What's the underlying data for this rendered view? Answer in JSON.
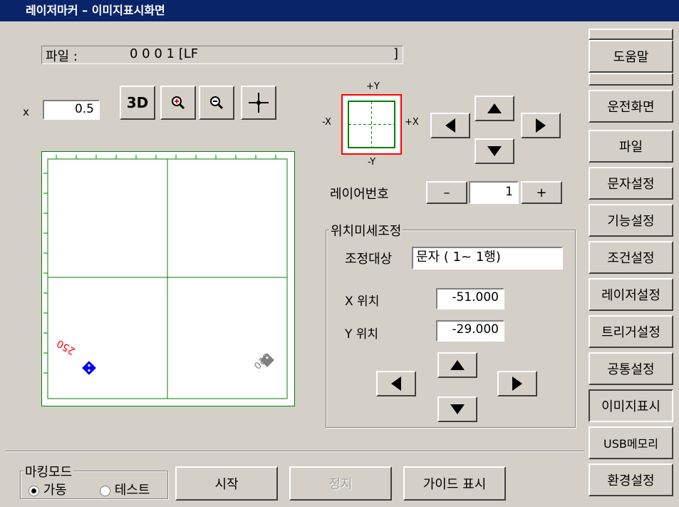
{
  "titlebar": {
    "title": "레이저마커  –  이미지표시화면"
  },
  "file_row": {
    "label": "파일 :",
    "value": "0 0 0 1  [LF",
    "close_bracket": "]"
  },
  "zoom": {
    "label": "x",
    "value": "0.5"
  },
  "toolbar": {
    "btn_3d": "3D"
  },
  "preview": {
    "mark_left_text": "250",
    "mark_right_text": "250",
    "colors": {
      "grid": "#008000",
      "mark_left": "#ff0000",
      "mark_left_block": "#0000ff",
      "mark_right": "#808080"
    }
  },
  "axis": {
    "plus_y": "+Y",
    "minus_y": "-Y",
    "minus_x": "-X",
    "plus_x": "+X"
  },
  "layer": {
    "label": "레이어번호",
    "minus": "–",
    "value": "1",
    "plus": "+"
  },
  "fine_adjust": {
    "title": "위치미세조정",
    "target_label": "조정대상",
    "target_value": "문자 ( 1~  1행)",
    "x_label": "X 위치",
    "x_value": "-51.000",
    "y_label": "Y 위치",
    "y_value": "-29.000"
  },
  "sidebar": {
    "items": [
      {
        "label": "도움말"
      },
      {
        "label": "운전화면"
      },
      {
        "label": "파일"
      },
      {
        "label": "문자설정"
      },
      {
        "label": "기능설정"
      },
      {
        "label": "조건설정"
      },
      {
        "label": "레이저설정"
      },
      {
        "label": "트리거설정"
      },
      {
        "label": "공통설정"
      },
      {
        "label": "이미지표시"
      },
      {
        "label": "USB메모리"
      },
      {
        "label": "환경설정"
      }
    ]
  },
  "bottom": {
    "mode_title": "마킹모드",
    "mode_run": "가동",
    "mode_test": "테스트",
    "start": "시작",
    "stop": "정지",
    "guide": "가이드 표시"
  }
}
